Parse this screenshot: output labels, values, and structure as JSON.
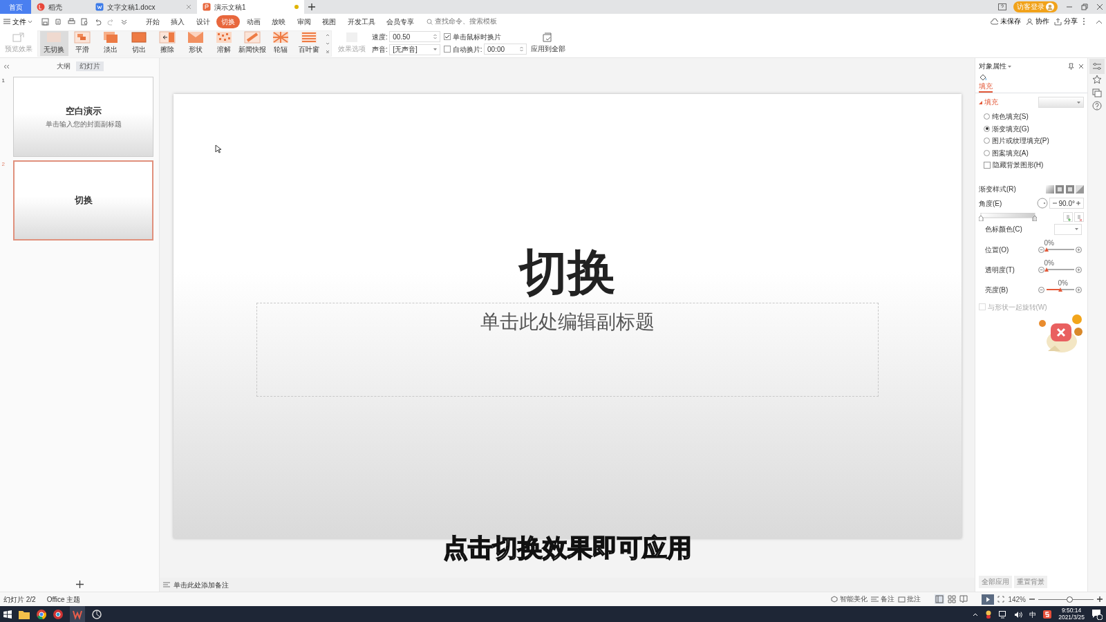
{
  "tabs": [
    {
      "label": "首页",
      "kind": "home",
      "selected": false,
      "modified": false
    },
    {
      "label": "稻壳",
      "kind": "docer",
      "selected": false,
      "modified": false
    },
    {
      "label": "文字文稿1.docx",
      "kind": "writer",
      "selected": false,
      "modified": false
    },
    {
      "label": "演示文稿1",
      "kind": "presentation",
      "selected": true,
      "modified": true
    }
  ],
  "account": {
    "login": "访客登录"
  },
  "menu": {
    "file": "文件",
    "tabs": [
      {
        "label": "开始",
        "selected": false
      },
      {
        "label": "插入",
        "selected": false
      },
      {
        "label": "设计",
        "selected": false
      },
      {
        "label": "切换",
        "selected": true
      },
      {
        "label": "动画",
        "selected": false
      },
      {
        "label": "放映",
        "selected": false
      },
      {
        "label": "审阅",
        "selected": false
      },
      {
        "label": "视图",
        "selected": false
      },
      {
        "label": "开发工具",
        "selected": false
      },
      {
        "label": "会员专享",
        "selected": false
      }
    ],
    "search": {
      "placeholder": "查找命令、搜索模板"
    },
    "actions": [
      {
        "label": "未保存",
        "kind": "cloud"
      },
      {
        "label": "协作",
        "kind": "person"
      },
      {
        "label": "分享",
        "kind": "share"
      }
    ]
  },
  "ribbon": {
    "preview": {
      "label": "预览效果",
      "disabled": true
    },
    "effects": [
      {
        "label": "无切换",
        "kind": "none",
        "selected": true
      },
      {
        "label": "平滑",
        "kind": "smooth",
        "selected": false
      },
      {
        "label": "淡出",
        "kind": "fade",
        "selected": false
      },
      {
        "label": "切出",
        "kind": "cut",
        "selected": false
      },
      {
        "label": "擦除",
        "kind": "wipe",
        "selected": false
      },
      {
        "label": "形状",
        "kind": "shape",
        "selected": false
      },
      {
        "label": "溶解",
        "kind": "dissolve",
        "selected": false
      },
      {
        "label": "新闻快报",
        "kind": "news",
        "selected": false
      },
      {
        "label": "轮辐",
        "kind": "wheel",
        "selected": false
      },
      {
        "label": "百叶窗",
        "kind": "blinds",
        "selected": false
      }
    ],
    "effect_options": {
      "label": "效果选项",
      "disabled": true
    },
    "speed": {
      "label": "速度:",
      "value": "00.50"
    },
    "sound": {
      "label": "声音:",
      "value": "[无声音]"
    },
    "on_click": {
      "label": "单击鼠标时换片",
      "checked": true
    },
    "auto_advance": {
      "label": "自动换片:",
      "checked": false,
      "value": "00:00"
    },
    "apply_all": "应用到全部"
  },
  "left_panel": {
    "tabs": [
      {
        "label": "大纲",
        "selected": false
      },
      {
        "label": "幻灯片",
        "selected": true
      }
    ],
    "slides": [
      {
        "number": "1",
        "title": "空白演示",
        "subtitle": "单击输入您的封面副标题",
        "selected": false
      },
      {
        "number": "2",
        "title": "切换",
        "selected": true
      }
    ]
  },
  "slide": {
    "title": "切换",
    "subtitle_placeholder": "单击此处编辑副标题"
  },
  "notes": {
    "placeholder": "单击此处添加备注"
  },
  "caption": "点击切换效果即可应用",
  "properties": {
    "title": "对象属性",
    "tab": "填充",
    "section": "填充",
    "fill_options": [
      {
        "label": "纯色填充(S)",
        "selected": false
      },
      {
        "label": "渐变填充(G)",
        "selected": true
      },
      {
        "label": "图片或纹理填充(P)",
        "selected": false
      },
      {
        "label": "图案填充(A)",
        "selected": false
      }
    ],
    "hide_background": {
      "label": "隐藏背景图形(H)",
      "checked": false
    },
    "gradient_style": "渐变样式(R)",
    "angle": {
      "label": "角度(E)",
      "value": "90.0°"
    },
    "stop_color": "色标颜色(C)",
    "sliders": [
      {
        "label": "位置(O)",
        "reading": "0%",
        "level": 0
      },
      {
        "label": "透明度(T)",
        "reading": "0%",
        "level": 0
      },
      {
        "label": "亮度(B)",
        "reading": "0%",
        "level": 0.5
      }
    ],
    "rotate_with_shape": {
      "label": "与形状一起旋转(W)",
      "checked": false,
      "disabled": true
    },
    "buttons": [
      "全部应用",
      "重置背景"
    ]
  },
  "status_bar": {
    "slide": "幻灯片 2/2",
    "theme": "Office 主题",
    "beautify": "智能美化",
    "notes": "备注",
    "comments": "批注",
    "zoom": "142%",
    "zoom_slider": {
      "level": 0.56
    }
  },
  "taskbar": {
    "ime": "中",
    "time": "9:50:14",
    "date": "2021/3/25"
  }
}
